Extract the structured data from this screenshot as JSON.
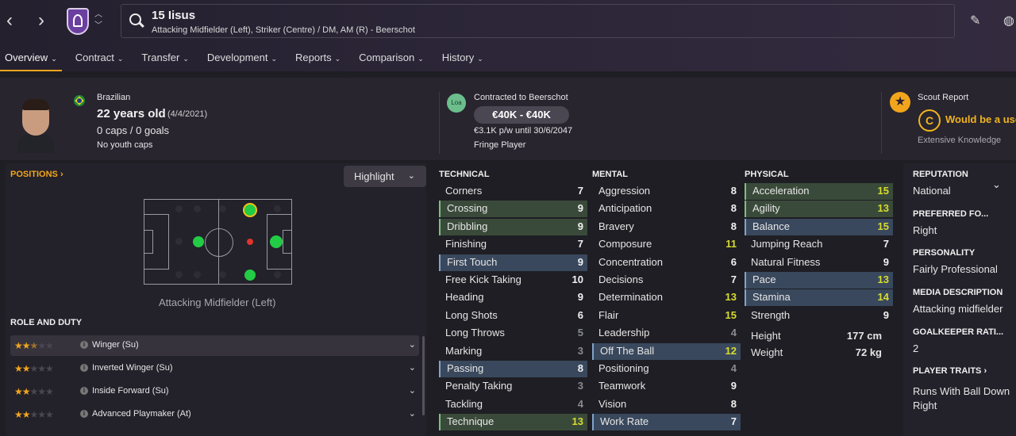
{
  "header": {
    "player_title": "15 Iisus",
    "player_subtitle": "Attacking Midfielder (Left), Striker (Centre) / DM, AM (R) - Beerschot"
  },
  "nav_icons": {
    "back": "chevron-left-icon",
    "forward": "chevron-right-icon",
    "edit": "pencil-icon",
    "world": "globe-icon"
  },
  "tabs": [
    "Overview",
    "Contract",
    "Transfer",
    "Development",
    "Reports",
    "Comparison",
    "History"
  ],
  "profile": {
    "nationality": "Brazilian",
    "age": "22 years old",
    "dob": "(4/4/2021)",
    "caps": "0 caps / 0 goals",
    "youth": "No youth caps"
  },
  "contract": {
    "loan_badge": "Loa",
    "title": "Contracted to Beerschot",
    "wage_range": "€40K - €40K",
    "wage_detail": "€3.1K p/w until 30/6/2047",
    "status": "Fringe Player"
  },
  "scout": {
    "title": "Scout Report",
    "grade": "C",
    "verdict": "Would be a use",
    "knowledge": "Extensive Knowledge"
  },
  "positions": {
    "title": "POSITIONS ›",
    "highlight": "Highlight",
    "label": "Attacking Midfielder (Left)"
  },
  "roles": {
    "title": "ROLE AND DUTY",
    "items": [
      {
        "name": "Winger (Su)",
        "stars": 2.5
      },
      {
        "name": "Inverted Winger (Su)",
        "stars": 2
      },
      {
        "name": "Inside Forward (Su)",
        "stars": 2
      },
      {
        "name": "Advanced Playmaker (At)",
        "stars": 2
      }
    ]
  },
  "technical": {
    "title": "TECHNICAL",
    "rows": [
      {
        "name": "Corners",
        "value": "7"
      },
      {
        "name": "Crossing",
        "value": "9"
      },
      {
        "name": "Dribbling",
        "value": "9"
      },
      {
        "name": "Finishing",
        "value": "7"
      },
      {
        "name": "First Touch",
        "value": "9"
      },
      {
        "name": "Free Kick Taking",
        "value": "10"
      },
      {
        "name": "Heading",
        "value": "9"
      },
      {
        "name": "Long Shots",
        "value": "6"
      },
      {
        "name": "Long Throws",
        "value": "5"
      },
      {
        "name": "Marking",
        "value": "3"
      },
      {
        "name": "Passing",
        "value": "8"
      },
      {
        "name": "Penalty Taking",
        "value": "3"
      },
      {
        "name": "Tackling",
        "value": "4"
      },
      {
        "name": "Technique",
        "value": "13"
      }
    ]
  },
  "mental": {
    "title": "MENTAL",
    "rows": [
      {
        "name": "Aggression",
        "value": "8"
      },
      {
        "name": "Anticipation",
        "value": "8"
      },
      {
        "name": "Bravery",
        "value": "8"
      },
      {
        "name": "Composure",
        "value": "11"
      },
      {
        "name": "Concentration",
        "value": "6"
      },
      {
        "name": "Decisions",
        "value": "7"
      },
      {
        "name": "Determination",
        "value": "13"
      },
      {
        "name": "Flair",
        "value": "15"
      },
      {
        "name": "Leadership",
        "value": "4"
      },
      {
        "name": "Off The Ball",
        "value": "12"
      },
      {
        "name": "Positioning",
        "value": "4"
      },
      {
        "name": "Teamwork",
        "value": "9"
      },
      {
        "name": "Vision",
        "value": "8"
      },
      {
        "name": "Work Rate",
        "value": "7"
      }
    ]
  },
  "physical": {
    "title": "PHYSICAL",
    "rows": [
      {
        "name": "Acceleration",
        "value": "15"
      },
      {
        "name": "Agility",
        "value": "13"
      },
      {
        "name": "Balance",
        "value": "15"
      },
      {
        "name": "Jumping Reach",
        "value": "7"
      },
      {
        "name": "Natural Fitness",
        "value": "9"
      },
      {
        "name": "Pace",
        "value": "13"
      },
      {
        "name": "Stamina",
        "value": "14"
      },
      {
        "name": "Strength",
        "value": "9"
      }
    ],
    "height_label": "Height",
    "height": "177 cm",
    "weight_label": "Weight",
    "weight": "72 kg"
  },
  "sidebar": [
    {
      "h": "REPUTATION",
      "v": "National"
    },
    {
      "h": "PREFERRED FO...",
      "v": "Right"
    },
    {
      "h": "PERSONALITY",
      "v": "Fairly Professional"
    },
    {
      "h": "MEDIA DESCRIPTION",
      "v": "Attacking midfielder"
    },
    {
      "h": "GOALKEEPER RATI...",
      "v": "2"
    },
    {
      "h": "PLAYER TRAITS ›",
      "v": "Runs With Ball Down Right"
    }
  ],
  "colors": {
    "accent": "#f2a51c",
    "highlight_value": "#d7dc2e",
    "dot": "#22cc44"
  }
}
